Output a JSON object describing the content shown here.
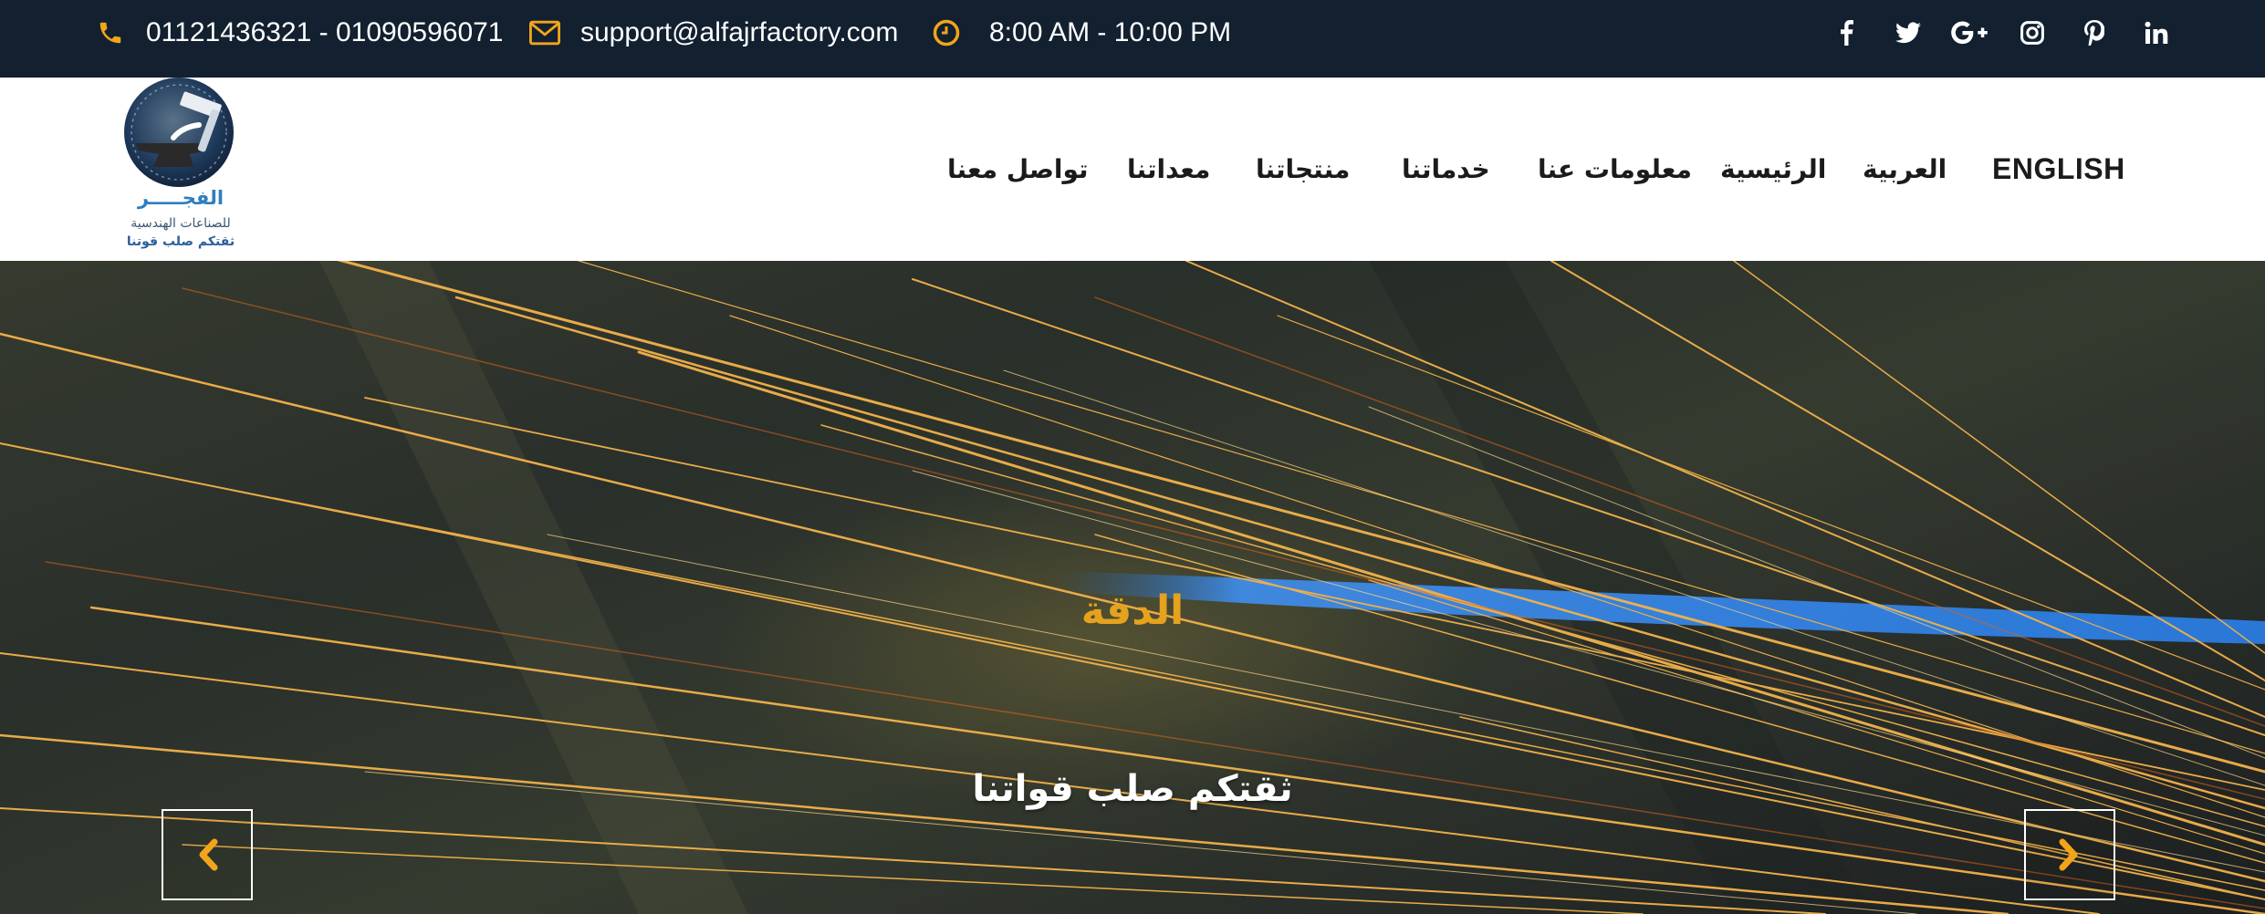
{
  "topbar": {
    "phone": "01121436321 - 01090596071",
    "email": "support@alfajrfactory.com",
    "hours": "8:00 AM - 10:00 PM",
    "accent_color": "#f2a51a",
    "social": [
      "facebook-icon",
      "twitter-icon",
      "google-plus-icon",
      "instagram-icon",
      "pinterest-icon",
      "linkedin-icon"
    ]
  },
  "logo": {
    "line1": "الفجـــــر",
    "line2": "للصناعات الهندسية",
    "line3": "ثقتكم  صلب قوتنا"
  },
  "nav": {
    "english": "ENGLISH",
    "arabic": "العربية",
    "home": "الرئيسية",
    "about": "معلومات عنا",
    "services": "خدماتنا",
    "products": "منتجاتنا",
    "equipment": "معداتنا",
    "contact": "تواصل معنا"
  },
  "hero": {
    "title": "الدقة",
    "subtitle": "ثقتكم صلب قواتنا",
    "title_color": "#e5a21c"
  }
}
